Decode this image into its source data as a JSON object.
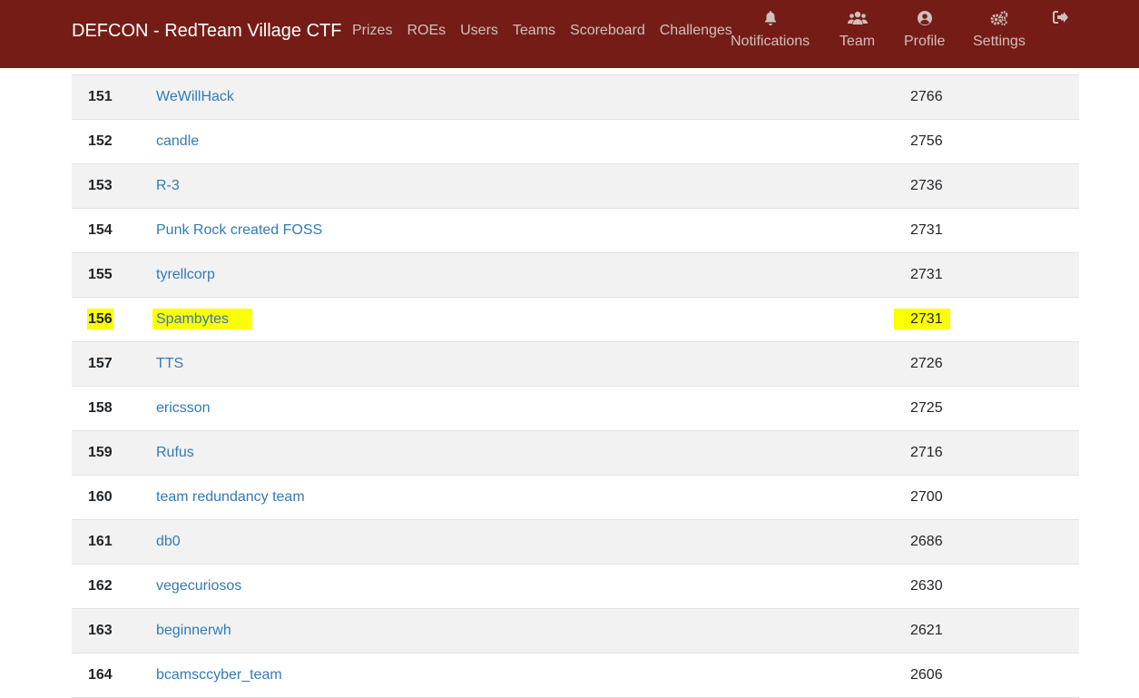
{
  "navbar": {
    "brand": "DEFCON - RedTeam Village CTF",
    "links": [
      "Prizes",
      "ROEs",
      "Users",
      "Teams",
      "Scoreboard",
      "Challenges"
    ],
    "icon_items": [
      {
        "label": "Notifications",
        "icon": "bell-icon"
      },
      {
        "label": "Team",
        "icon": "users-icon"
      },
      {
        "label": "Profile",
        "icon": "user-circle-icon"
      },
      {
        "label": "Settings",
        "icon": "gears-icon"
      },
      {
        "label": "",
        "icon": "sign-out-icon"
      }
    ],
    "background_color": "#751c16"
  },
  "scoreboard": {
    "rows": [
      {
        "rank": "151",
        "team": "WeWillHack",
        "score": "2766"
      },
      {
        "rank": "152",
        "team": "candle",
        "score": "2756"
      },
      {
        "rank": "153",
        "team": "R-3",
        "score": "2736"
      },
      {
        "rank": "154",
        "team": "Punk Rock created FOSS",
        "score": "2731"
      },
      {
        "rank": "155",
        "team": "tyrellcorp",
        "score": "2731"
      },
      {
        "rank": "156",
        "team": "Spambytes",
        "score": "2731",
        "highlighted": true
      },
      {
        "rank": "157",
        "team": "TTS",
        "score": "2726"
      },
      {
        "rank": "158",
        "team": "ericsson",
        "score": "2725"
      },
      {
        "rank": "159",
        "team": "Rufus",
        "score": "2716"
      },
      {
        "rank": "160",
        "team": "team redundancy team",
        "score": "2700"
      },
      {
        "rank": "161",
        "team": "db0",
        "score": "2686"
      },
      {
        "rank": "162",
        "team": "vegecuriosos",
        "score": "2630"
      },
      {
        "rank": "163",
        "team": "beginnerwh",
        "score": "2621"
      },
      {
        "rank": "164",
        "team": "bcamsccyber_team",
        "score": "2606"
      }
    ],
    "highlight_color": "#fbff00",
    "link_color": "#337ab7"
  }
}
